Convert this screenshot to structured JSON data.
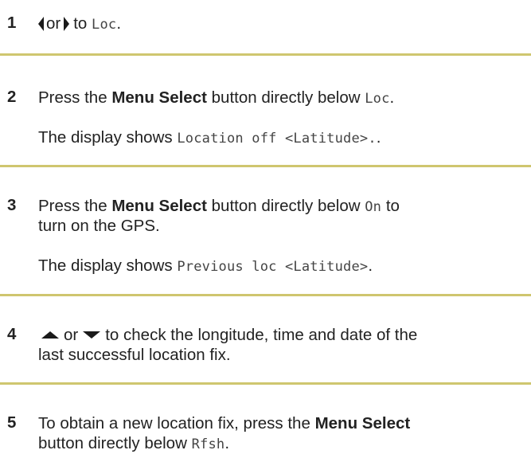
{
  "steps": [
    {
      "number": "1",
      "or": "or",
      "to": "to",
      "code": "Loc",
      "end": "."
    },
    {
      "number": "2",
      "pre": "Press the",
      "button": "Menu Select",
      "post": "button directly below",
      "code": "Loc",
      "end": ".",
      "result_pre": "The display shows",
      "result_code": "Location off <Latitude>.",
      "result_end": "."
    },
    {
      "number": "3",
      "pre": "Press the",
      "button": "Menu Select",
      "post": "button directly below",
      "code": "On",
      "post2": "to",
      "line2": "turn on the GPS.",
      "result_pre": "The display shows",
      "result_code": "Previous loc <Latitude>",
      "result_end": "."
    },
    {
      "number": "4",
      "or": "or",
      "text": "to check the longitude, time and date of the",
      "line2": "last successful location fix."
    },
    {
      "number": "5",
      "pre": "To obtain a new location fix, press the",
      "button": "Menu Select",
      "line2_pre": "button directly below",
      "code": "Rfsh",
      "end": "."
    }
  ],
  "icons": {
    "left": "left-arrow-icon",
    "right": "right-arrow-icon",
    "up": "up-arrow-icon",
    "down": "down-arrow-icon"
  },
  "colors": {
    "divider": "#cfc66f",
    "text": "#222222"
  }
}
